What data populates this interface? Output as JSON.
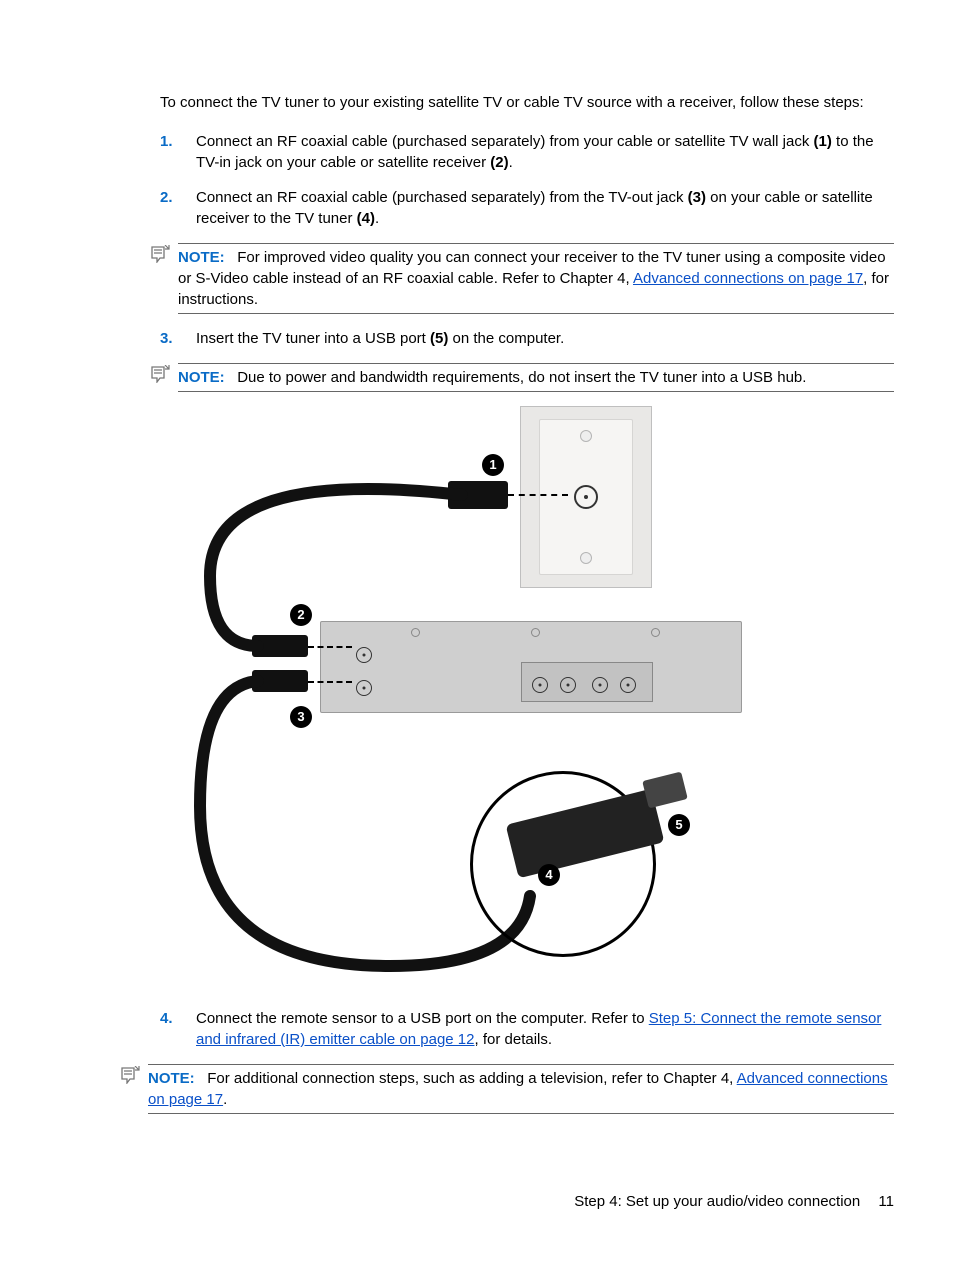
{
  "intro": "To connect the TV tuner to your existing satellite TV or cable TV source with a receiver, follow these steps:",
  "steps": {
    "s1_a": "Connect an RF coaxial cable (purchased separately) from your cable or satellite TV wall jack ",
    "s1_b1": "(1)",
    "s1_c": " to the TV-in jack on your cable or satellite receiver ",
    "s1_b2": "(2)",
    "s1_d": ".",
    "s2_a": "Connect an RF coaxial cable (purchased separately) from the TV-out jack ",
    "s2_b1": "(3)",
    "s2_c": " on your cable or satellite receiver to the TV tuner ",
    "s2_b2": "(4)",
    "s2_d": ".",
    "s3_a": "Insert the TV tuner into a USB port ",
    "s3_b1": "(5)",
    "s3_c": " on the computer.",
    "s4_a": "Connect the remote sensor to a USB port on the computer. Refer to ",
    "s4_link": "Step 5: Connect the remote sensor and infrared (IR) emitter cable on page 12",
    "s4_b": ", for details."
  },
  "notes": {
    "label": "NOTE:",
    "n1_a": "For improved video quality you can connect your receiver to the TV tuner using a composite video or S-Video cable instead of an RF coaxial cable. Refer to Chapter 4, ",
    "n1_link": "Advanced connections on page 17",
    "n1_b": ", for instructions.",
    "n2": "Due to power and bandwidth requirements, do not insert the TV tuner into a USB hub.",
    "n3_a": "For additional connection steps, such as adding a television, refer to Chapter 4, ",
    "n3_link": "Advanced connections on page 17",
    "n3_b": "."
  },
  "callouts": {
    "c1": "1",
    "c2": "2",
    "c3": "3",
    "c4": "4",
    "c5": "5"
  },
  "nums": {
    "n1": "1.",
    "n2": "2.",
    "n3": "3.",
    "n4": "4."
  },
  "footer": {
    "title": "Step 4: Set up your audio/video connection",
    "page": "11"
  }
}
